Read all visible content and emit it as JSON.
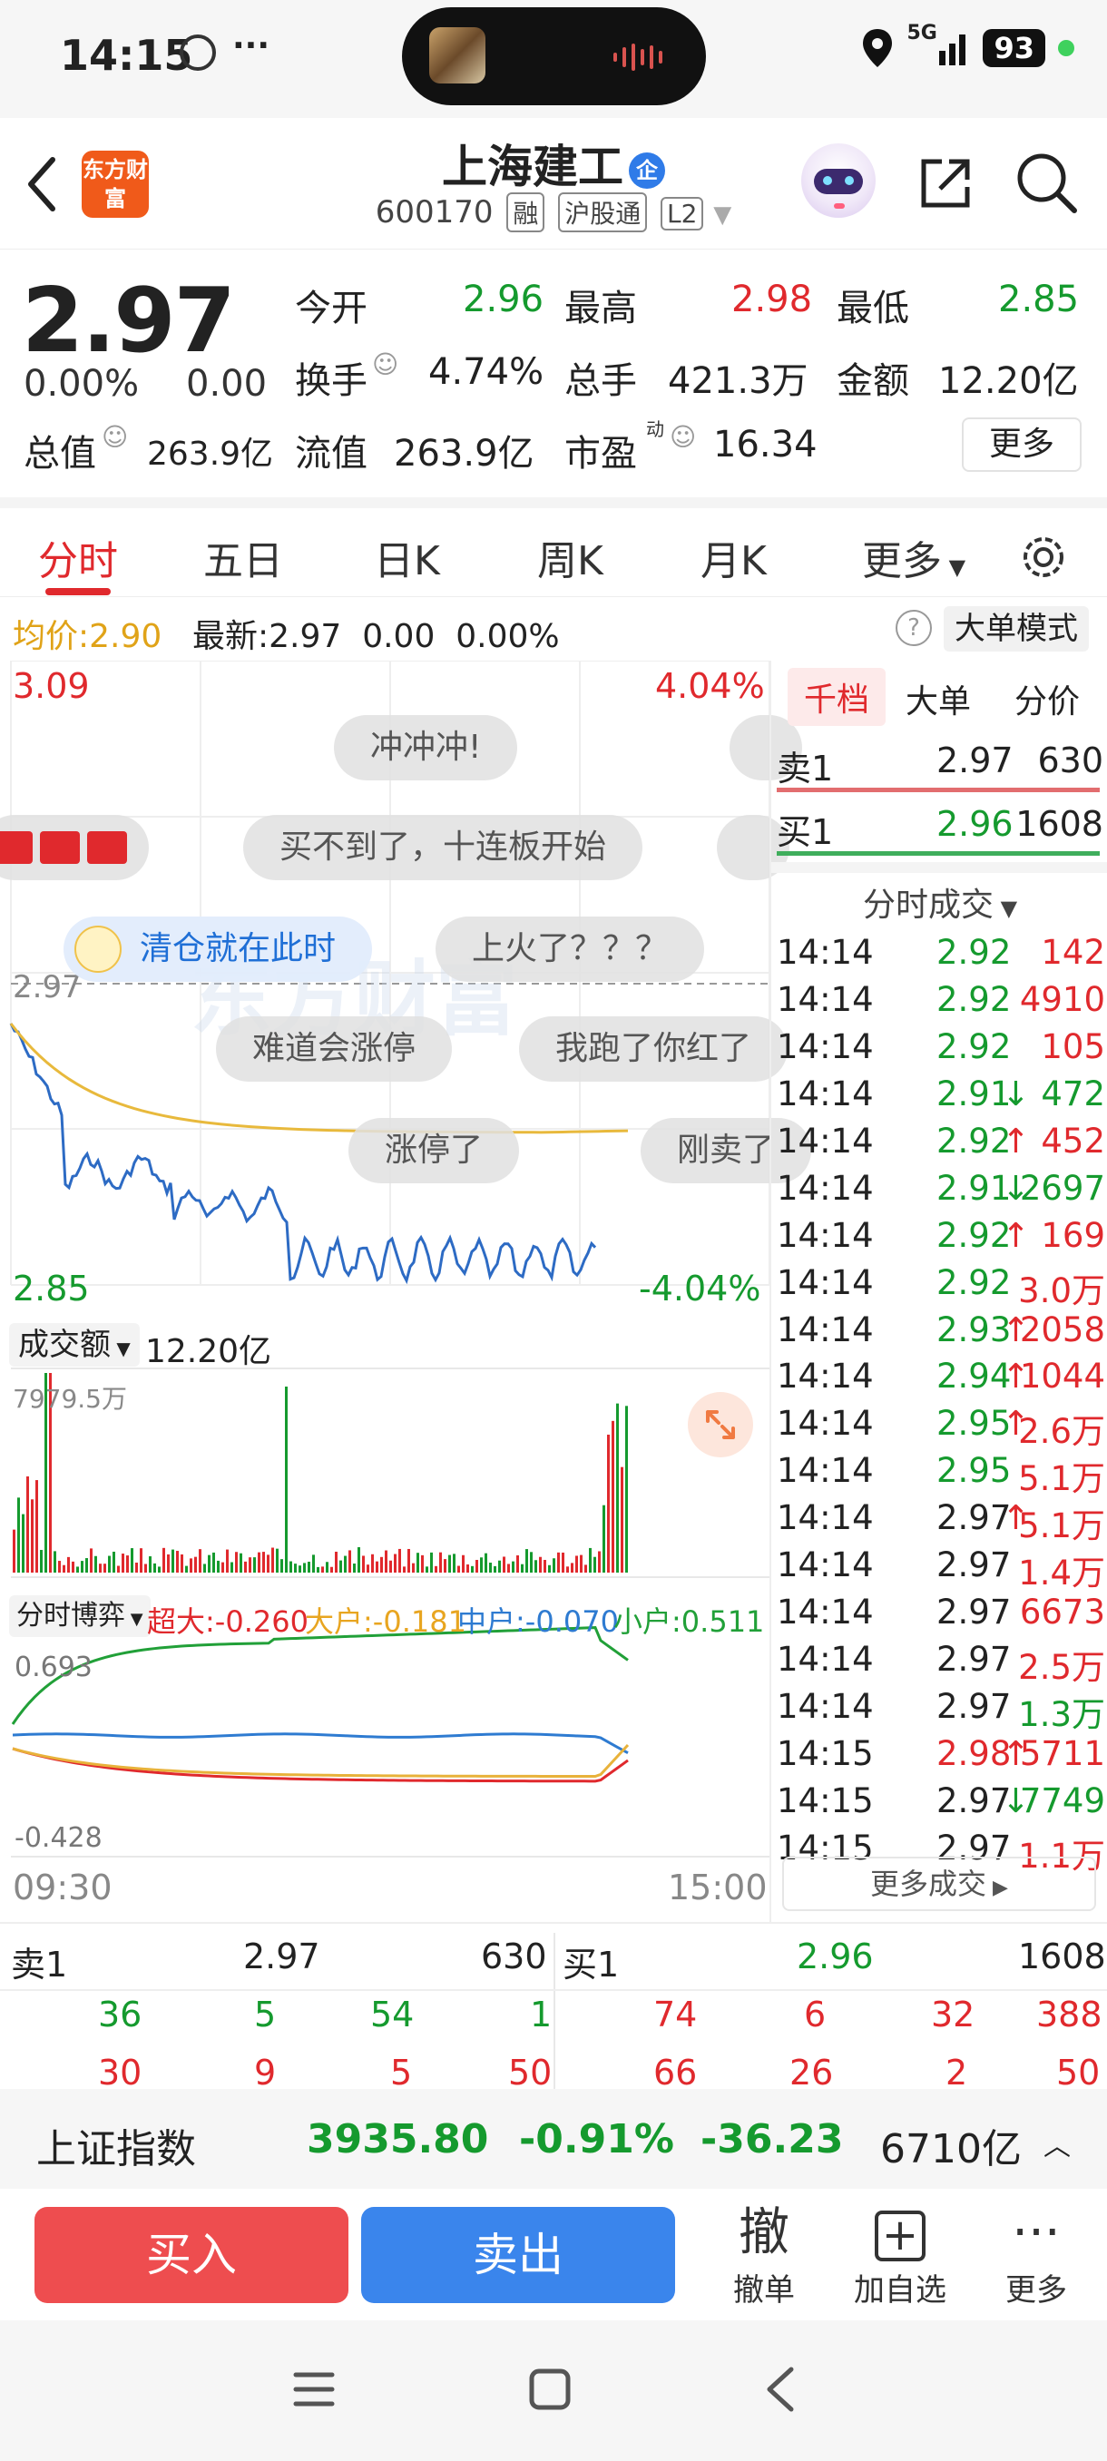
{
  "status": {
    "time": "14:15",
    "more": "···",
    "net": "5G",
    "battery": "93"
  },
  "header": {
    "title": "上海建工",
    "title_badge": "企",
    "code": "600170",
    "tags": [
      "融",
      "沪股通",
      "L2"
    ],
    "logo": "东方财富"
  },
  "quote": {
    "price": "2.97",
    "change_pct": "0.00%",
    "change": "0.00",
    "open_label": "今开",
    "open": "2.96",
    "high_label": "最高",
    "high": "2.98",
    "low_label": "最低",
    "low": "2.85",
    "turnover_label": "换手",
    "turnover": "4.74%",
    "volume_label": "总手",
    "volume": "421.3万",
    "amount_label": "金额",
    "amount": "12.20亿",
    "mktcap_label": "总值",
    "mktcap": "263.9亿",
    "float_label": "流值",
    "float_cap": "263.9亿",
    "pe_label": "市盈",
    "pe_sup": "动",
    "pe": "16.34",
    "more": "更多"
  },
  "tabs": [
    "分时",
    "五日",
    "日K",
    "周K",
    "月K",
    "更多"
  ],
  "avgrow": {
    "avg_label": "均价:",
    "avg": "2.90",
    "latest_label": "最新:",
    "latest": "2.97",
    "chg": "0.00",
    "chg_pct": "0.00%",
    "bigmode": "大单模式",
    "help": "?"
  },
  "chart": {
    "y_top_left": "3.09",
    "y_top_right": "4.04%",
    "y_bottom_left": "2.85",
    "y_bottom_right": "-4.04%",
    "ref_price": "2.97",
    "watermark": "东方财富",
    "volume_label": "成交额",
    "volume_total": "12.20亿",
    "volume_max": "7979.5万",
    "flow_label": "分时博弈",
    "flow_super_label": "超大:",
    "flow_super": "-0.260",
    "flow_big_label": "大户:",
    "flow_big": "-0.181",
    "flow_mid_label": "中户:",
    "flow_mid": "-0.070",
    "flow_small_label": "小户:",
    "flow_small": "0.511",
    "flow_max": "0.693",
    "flow_min": "-0.428",
    "t_start": "09:30",
    "t_end": "15:00",
    "colors": {
      "price": "#2d6bc4",
      "avg": "#e8b93c",
      "up": "#e0292d",
      "down": "#159a2e",
      "super": "#e0292d",
      "big": "#e8b23a",
      "mid": "#2e7bd1",
      "small": "#21a038"
    }
  },
  "danmu": [
    "冲冲冲!",
    "买不到了，十连板开始",
    "清仓就在此时",
    "上火了？？？",
    "难道会涨停",
    "我跑了你红了",
    "涨停了",
    "刚卖了"
  ],
  "book": {
    "tabs": [
      "千档",
      "大单",
      "分价"
    ],
    "sell1": {
      "label": "卖1",
      "price": "2.97",
      "vol": "630"
    },
    "buy1": {
      "label": "买1",
      "price": "2.96",
      "vol": "1608"
    },
    "trades_title": "分时成交",
    "trades": [
      {
        "t": "14:14",
        "p": "2.92",
        "arrow": "",
        "v": "142",
        "pc": "green",
        "vc": "red"
      },
      {
        "t": "14:14",
        "p": "2.92",
        "arrow": "",
        "v": "4910",
        "pc": "green",
        "vc": "red"
      },
      {
        "t": "14:14",
        "p": "2.92",
        "arrow": "",
        "v": "105",
        "pc": "green",
        "vc": "red"
      },
      {
        "t": "14:14",
        "p": "2.91",
        "arrow": "↓",
        "v": "472",
        "pc": "green",
        "vc": "green"
      },
      {
        "t": "14:14",
        "p": "2.92",
        "arrow": "↑",
        "v": "452",
        "pc": "green",
        "vc": "red"
      },
      {
        "t": "14:14",
        "p": "2.91",
        "arrow": "↓",
        "v": "2697",
        "pc": "green",
        "vc": "green"
      },
      {
        "t": "14:14",
        "p": "2.92",
        "arrow": "↑",
        "v": "169",
        "pc": "green",
        "vc": "red"
      },
      {
        "t": "14:14",
        "p": "2.92",
        "arrow": "",
        "v": "3.0万",
        "pc": "green",
        "vc": "red"
      },
      {
        "t": "14:14",
        "p": "2.93",
        "arrow": "↑",
        "v": "2058",
        "pc": "green",
        "vc": "red"
      },
      {
        "t": "14:14",
        "p": "2.94",
        "arrow": "↑",
        "v": "1044",
        "pc": "green",
        "vc": "red"
      },
      {
        "t": "14:14",
        "p": "2.95",
        "arrow": "↑",
        "v": "2.6万",
        "pc": "green",
        "vc": "red"
      },
      {
        "t": "14:14",
        "p": "2.95",
        "arrow": "",
        "v": "5.1万",
        "pc": "green",
        "vc": "red"
      },
      {
        "t": "14:14",
        "p": "2.97",
        "arrow": "↑",
        "v": "5.1万",
        "pc": "black",
        "vc": "red"
      },
      {
        "t": "14:14",
        "p": "2.97",
        "arrow": "",
        "v": "1.4万",
        "pc": "black",
        "vc": "red"
      },
      {
        "t": "14:14",
        "p": "2.97",
        "arrow": "",
        "v": "6673",
        "pc": "black",
        "vc": "red"
      },
      {
        "t": "14:14",
        "p": "2.97",
        "arrow": "",
        "v": "2.5万",
        "pc": "black",
        "vc": "red"
      },
      {
        "t": "14:14",
        "p": "2.97",
        "arrow": "",
        "v": "1.3万",
        "pc": "black",
        "vc": "green"
      },
      {
        "t": "14:15",
        "p": "2.98",
        "arrow": "↑",
        "v": "5711",
        "pc": "red",
        "vc": "red"
      },
      {
        "t": "14:15",
        "p": "2.97",
        "arrow": "↓",
        "v": "7749",
        "pc": "black",
        "vc": "green"
      },
      {
        "t": "14:15",
        "p": "2.97",
        "arrow": "",
        "v": "1.1万",
        "pc": "black",
        "vc": "red"
      }
    ],
    "more_trades": "更多成交"
  },
  "depth": {
    "sell_label": "卖1",
    "sell_price": "2.97",
    "sell_vol": "630",
    "buy_label": "买1",
    "buy_price": "2.96",
    "buy_vol": "1608",
    "left_rows": [
      [
        "36",
        "5",
        "54",
        "1"
      ],
      [
        "30",
        "9",
        "5",
        "50"
      ]
    ],
    "right_rows": [
      [
        "74",
        "6",
        "32",
        "388"
      ],
      [
        "66",
        "26",
        "2",
        "50"
      ]
    ]
  },
  "index": {
    "name": "上证指数",
    "value": "3935.80",
    "pct": "-0.91%",
    "change": "-36.23",
    "amount": "6710亿"
  },
  "actions": {
    "buy": "买入",
    "sell": "卖出",
    "cancel_icon": "撤",
    "cancel": "撤单",
    "watch_icon": "+",
    "watch": "加自选",
    "more_icon": "···",
    "more": "更多"
  }
}
